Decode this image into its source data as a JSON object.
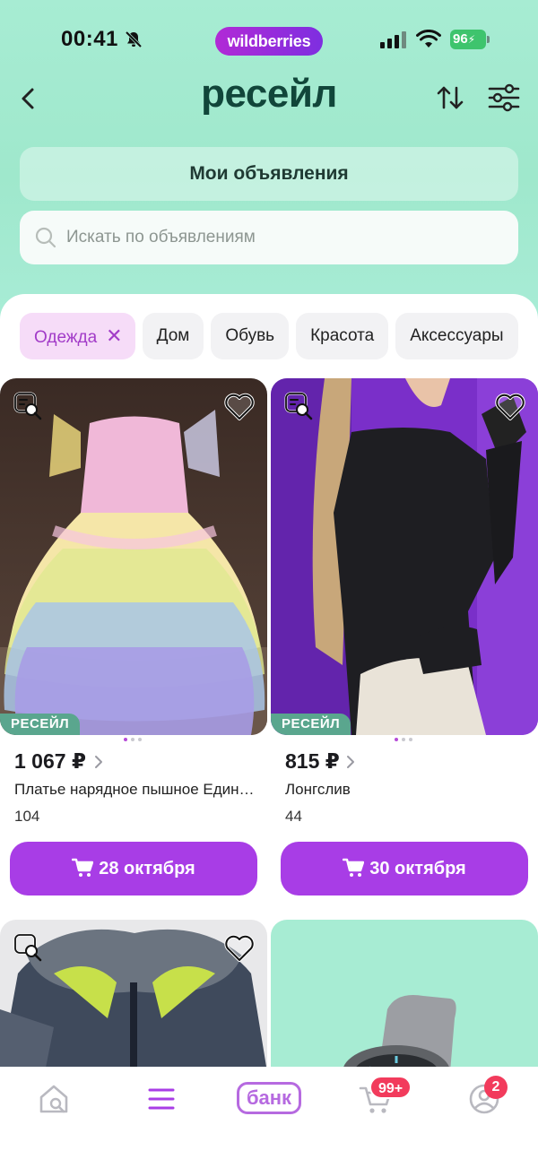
{
  "status_bar": {
    "time": "00:41",
    "brand": "wildberries",
    "battery": "96"
  },
  "header": {
    "title": "ресейл"
  },
  "my_ads_label": "Мои объявления",
  "search": {
    "placeholder": "Искать по объявлениям"
  },
  "categories": [
    {
      "label": "Одежда",
      "active": true
    },
    {
      "label": "Дом",
      "active": false
    },
    {
      "label": "Обувь",
      "active": false
    },
    {
      "label": "Красота",
      "active": false
    },
    {
      "label": "Аксессуары",
      "active": false
    }
  ],
  "products": [
    {
      "badge": "РЕСЕЙЛ",
      "price": "1 067 ₽",
      "title": "Платье нарядное пышное Един…",
      "size": "104",
      "delivery": "28 октября"
    },
    {
      "badge": "РЕСЕЙЛ",
      "price": "815 ₽",
      "title": "Лонгслив",
      "size": "44",
      "delivery": "30 октября"
    }
  ],
  "bottom_nav": {
    "bank_label": "банк",
    "cart_badge": "99+",
    "profile_badge": "2"
  },
  "colors": {
    "accent": "#a83de6",
    "header_bg": "#a7ecd3",
    "resale_badge": "#5aa68e",
    "notification_badge": "#f23b5c"
  },
  "icons": [
    "bell-muted-icon",
    "signal-icon",
    "wifi-icon",
    "back-icon",
    "sort-icon",
    "filter-icon",
    "search-icon",
    "close-icon",
    "similar-search-icon",
    "heart-icon",
    "chevron-right-icon",
    "cart-icon",
    "home-search-icon",
    "menu-icon",
    "profile-icon"
  ]
}
